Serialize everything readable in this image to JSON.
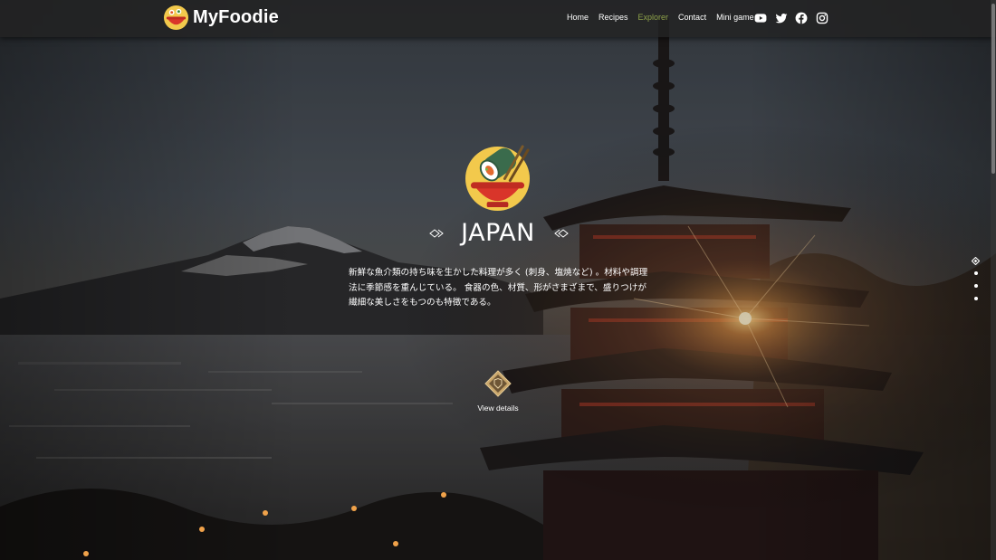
{
  "brand": {
    "name": "MyFoodie",
    "logo_icon": "foodie-logo-icon"
  },
  "nav": {
    "items": [
      {
        "label": "Home",
        "active": false
      },
      {
        "label": "Recipes",
        "active": false
      },
      {
        "label": "Explorer",
        "active": true
      },
      {
        "label": "Contact",
        "active": false
      },
      {
        "label": "Mini game",
        "active": false
      }
    ],
    "active_color": "#8ea24a"
  },
  "socials": [
    "youtube-icon",
    "twitter-icon",
    "facebook-icon",
    "instagram-icon"
  ],
  "hero": {
    "country": "JAPAN",
    "emblem_icon": "sushi-bowl-icon",
    "description": "新鮮な魚介類の持ち味を生かした料理が多く (刺身、塩焼など) 。材料や調理法に季節感を重んじている。 食器の色、材質、形がさまざまで、盛りつけが繊細な美しさをもつのも特徴である。",
    "details_label": "View details",
    "details_icon": "diamond-badge-icon"
  },
  "slides": {
    "count": 4,
    "active": 1
  },
  "colors": {
    "navbar": "#222222",
    "text": "#ffffff",
    "emblem_circle": "#f2c94c",
    "bowl": "#d9352a"
  }
}
